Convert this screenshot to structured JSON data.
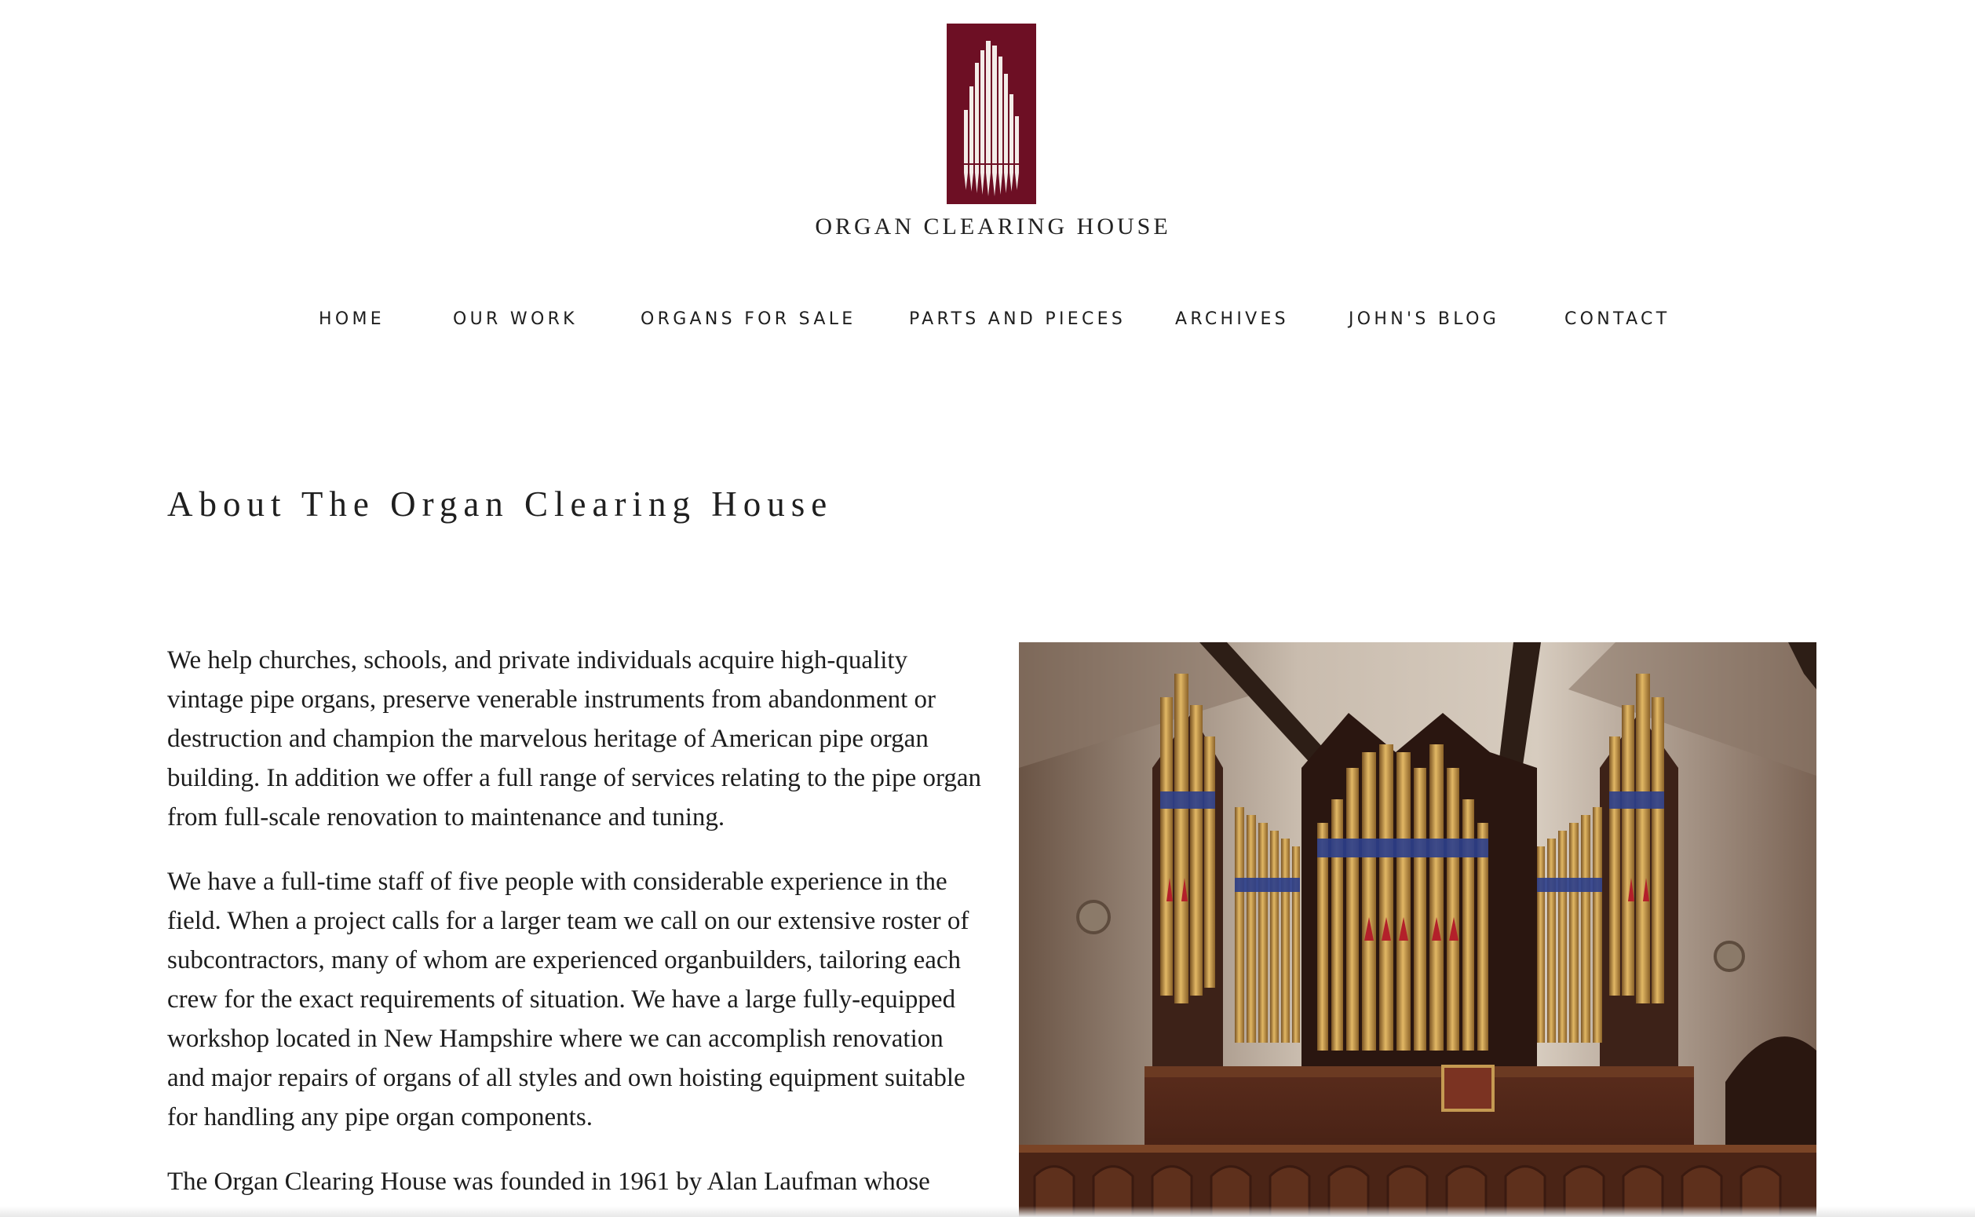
{
  "brand": {
    "logo_text": "ORGAN CLEARING HOUSE",
    "logo_color": "#6d0f24"
  },
  "nav": {
    "items": [
      {
        "label": "HOME"
      },
      {
        "label": "OUR WORK"
      },
      {
        "label": "ORGANS FOR SALE"
      },
      {
        "label": "PARTS AND PIECES"
      },
      {
        "label": "ARCHIVES"
      },
      {
        "label": "JOHN'S BLOG"
      },
      {
        "label": "CONTACT"
      }
    ]
  },
  "main": {
    "title": "About The Organ Clearing House",
    "paragraphs": [
      "We help churches, schools, and private individuals acquire high-quality vintage pipe organs, preserve venerable instruments from abandonment or destruction and champion the marvelous heritage of American pipe organ building. In addition we offer a full range of services relating to the pipe organ from full-scale renovation to maintenance and tuning.",
      "We have a full-time staff of five people with considerable experience in the field. When a project calls for a larger team we call on our extensive roster of subcontractors, many of whom are experienced organbuilders, tailoring each crew for the exact requirements of situation. We have a large fully-equipped workshop located in New Hampshire where we can accomplish renovation and major repairs of organs of all styles and own hoisting equipment suitable for handling any pipe organ components.",
      "The Organ Clearing House was founded in 1961 by Alan Laufman whose"
    ],
    "photo_icon": "pipe-organ-photo"
  }
}
